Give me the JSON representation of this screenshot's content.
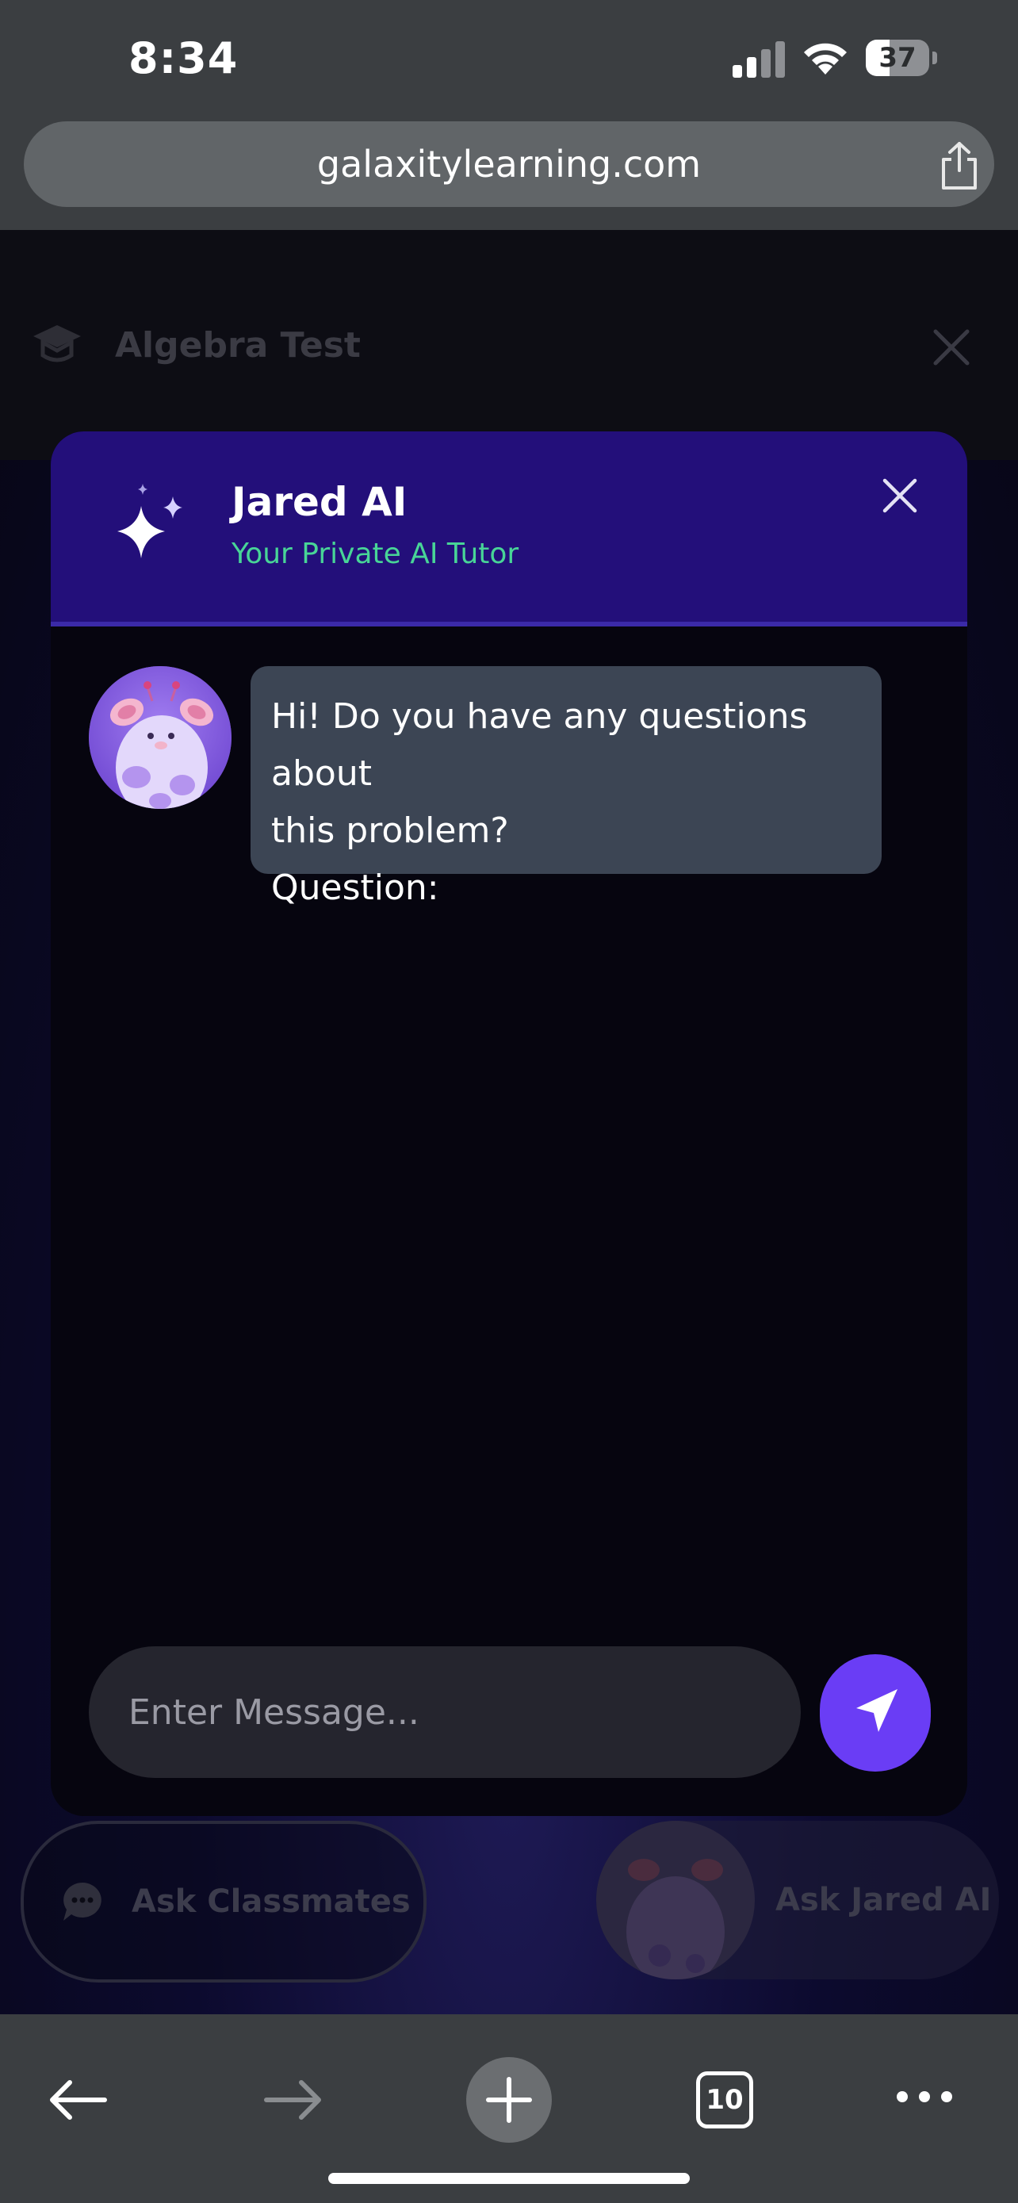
{
  "status_bar": {
    "time": "8:34",
    "battery_level": "37",
    "battery_fraction": 0.37,
    "icons": [
      "signal-icon",
      "wifi-icon",
      "battery-icon"
    ]
  },
  "browser": {
    "url": "galaxitylearning.com",
    "share_icon": "share-icon",
    "toolbar": {
      "back_icon": "back-arrow-icon",
      "forward_icon": "forward-arrow-icon",
      "new_tab_icon": "plus-icon",
      "tab_count": "10",
      "more_icon": "more-icon"
    }
  },
  "page": {
    "title": "Algebra Test",
    "title_icon": "graduation-cap-icon",
    "close_icon": "close-icon",
    "ask_classmates_label": "Ask Classmates",
    "ask_jared_label": "Ask Jared AI"
  },
  "chat": {
    "title": "Jared AI",
    "subtitle": "Your Private AI Tutor",
    "header_icon": "sparkle-icon",
    "close_icon": "close-icon",
    "messages": [
      {
        "from": "Jared AI",
        "lines": [
          "Hi! Do you have any questions about",
          "this problem?",
          "Question:"
        ]
      }
    ],
    "input_placeholder": "Enter Message...",
    "send_icon": "send-icon"
  },
  "colors": {
    "header_bg": "#230f7a",
    "subtitle": "#48d597",
    "bubble_bg": "#3c4554",
    "send_button": "#6a3df5",
    "browser_chrome": "#3b3e41"
  }
}
